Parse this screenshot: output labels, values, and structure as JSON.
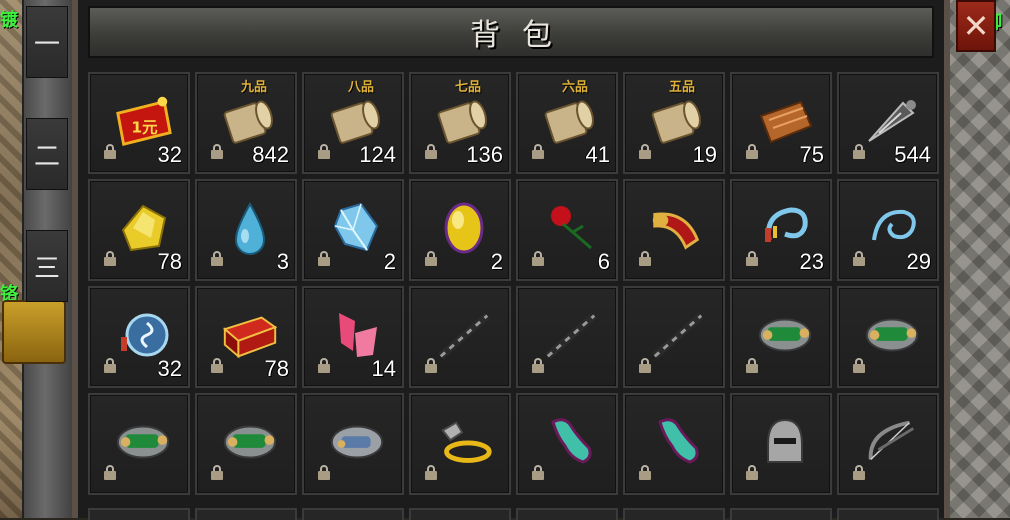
{
  "window": {
    "title": "背包",
    "close_glyph": "✕"
  },
  "scene": {
    "left_labels": [
      "镀",
      "铬"
    ],
    "right_label": "御",
    "side_tabs": [
      "一",
      "二",
      "三"
    ]
  },
  "inventory": {
    "rows": [
      [
        {
          "icon": "red-yuan-voucher-icon",
          "count": "32",
          "locked": true,
          "badge": "1元"
        },
        {
          "icon": "scroll-icon",
          "count": "842",
          "locked": true,
          "grade": "九品"
        },
        {
          "icon": "scroll-icon",
          "count": "124",
          "locked": true,
          "grade": "八品"
        },
        {
          "icon": "scroll-icon",
          "count": "136",
          "locked": true,
          "grade": "七品"
        },
        {
          "icon": "scroll-icon",
          "count": "41",
          "locked": true,
          "grade": "六品"
        },
        {
          "icon": "scroll-icon",
          "count": "19",
          "locked": true,
          "grade": "五品"
        },
        {
          "icon": "book-icon",
          "count": "75",
          "locked": true
        },
        {
          "icon": "drill-icon",
          "count": "544",
          "locked": true
        }
      ],
      [
        {
          "icon": "gold-gem-icon",
          "count": "78",
          "locked": true
        },
        {
          "icon": "water-drop-icon",
          "count": "3",
          "locked": true
        },
        {
          "icon": "blue-crystal-icon",
          "count": "2",
          "locked": true
        },
        {
          "icon": "yellow-orb-icon",
          "count": "2",
          "locked": true
        },
        {
          "icon": "red-rose-icon",
          "count": "6",
          "locked": true
        },
        {
          "icon": "horn-icon",
          "count": "",
          "locked": true
        },
        {
          "icon": "blue-charm-icon",
          "count": "23",
          "locked": true
        },
        {
          "icon": "blue-swirl-icon",
          "count": "29",
          "locked": true
        }
      ],
      [
        {
          "icon": "swirl-amulet-icon",
          "count": "32",
          "locked": true
        },
        {
          "icon": "red-chest-icon",
          "count": "78",
          "locked": true
        },
        {
          "icon": "pink-flag-icon",
          "count": "14",
          "locked": true
        },
        {
          "icon": "staff-icon",
          "count": "",
          "locked": true
        },
        {
          "icon": "staff-icon",
          "count": "",
          "locked": true
        },
        {
          "icon": "staff-icon",
          "count": "",
          "locked": true
        },
        {
          "icon": "green-bracer-icon",
          "count": "",
          "locked": true
        },
        {
          "icon": "green-bracer-icon",
          "count": "",
          "locked": true
        }
      ],
      [
        {
          "icon": "green-bracer-icon",
          "count": "",
          "locked": true
        },
        {
          "icon": "green-bracer-icon",
          "count": "",
          "locked": true
        },
        {
          "icon": "gray-bracer-icon",
          "count": "",
          "locked": true
        },
        {
          "icon": "gold-ring-icon",
          "count": "",
          "locked": true
        },
        {
          "icon": "teal-boot-icon",
          "count": "",
          "locked": true
        },
        {
          "icon": "teal-boot-icon",
          "count": "",
          "locked": true
        },
        {
          "icon": "helmet-icon",
          "count": "",
          "locked": true
        },
        {
          "icon": "bow-icon",
          "count": "",
          "locked": true
        }
      ]
    ]
  },
  "colors": {
    "panel_bg": "#1c1c1c",
    "slot_border": "#3b3b3b",
    "grade_gold": "#e0b23a",
    "close_red": "#9c2a1a"
  }
}
